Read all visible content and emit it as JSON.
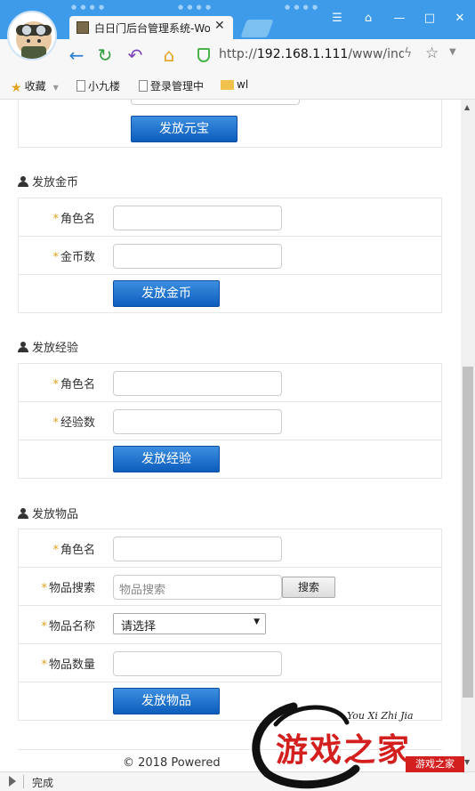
{
  "browser": {
    "tab_title": "白日门后台管理系统-Wo",
    "tab_close": "✕",
    "url_prefix": "http://",
    "url_host": "192.168.1.111",
    "url_path": "/www/inde",
    "bookmarks": [
      {
        "label": "收藏",
        "icon": "star-icon"
      },
      {
        "label": "小九楼",
        "icon": "page-icon"
      },
      {
        "label": "登录管理中",
        "icon": "page-icon"
      },
      {
        "label": "wl",
        "icon": "folder-icon"
      }
    ],
    "status_text": "完成"
  },
  "form": {
    "yuanbao_button": "发放元宝",
    "gold": {
      "title": "发放金币",
      "role_label": "角色名",
      "amount_label": "金币数",
      "submit": "发放金币"
    },
    "exp": {
      "title": "发放经验",
      "role_label": "角色名",
      "amount_label": "经验数",
      "submit": "发放经验"
    },
    "item": {
      "title": "发放物品",
      "role_label": "角色名",
      "search_label": "物品搜索",
      "search_placeholder": "物品搜索",
      "search_button": "搜索",
      "name_label": "物品名称",
      "name_selected": "请选择",
      "qty_label": "物品数量",
      "submit": "发放物品"
    }
  },
  "footer": "© 2018 Powered",
  "watermark": {
    "script": "You Xi Zhi Jia",
    "big": "游戏之家",
    "small": "游戏之家"
  },
  "colors": {
    "titlebar": "#3d9be9",
    "button_blue": "#0d5dbd",
    "required": "#e4a11b",
    "watermark_red": "#d41f1f"
  }
}
